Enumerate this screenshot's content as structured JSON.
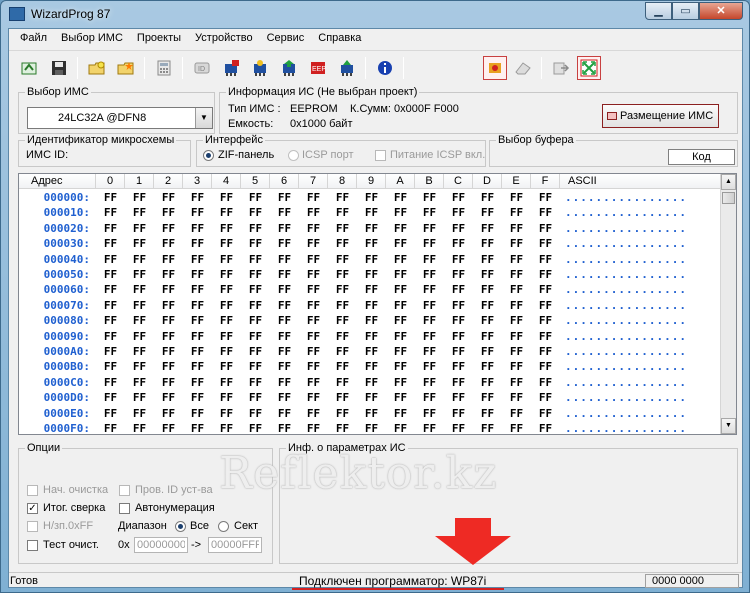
{
  "window": {
    "title": "WizardProg 87"
  },
  "menu": [
    "Файл",
    "Выбор ИМС",
    "Проекты",
    "Устройство",
    "Сервис",
    "Справка"
  ],
  "toolbar": {
    "icons": [
      "open-icon",
      "save-icon",
      "folder-open-icon",
      "folder-star-icon",
      "calculator-icon",
      "chip-id-icon",
      "chip-read-icon",
      "chip-blank-icon",
      "chip-write-icon",
      "chip-verify-icon",
      "chip-erase-icon",
      "info-icon",
      "chip-settings-icon",
      "eraser-icon",
      "export-icon",
      "fit-screen-icon"
    ]
  },
  "chip_select": {
    "group": "Выбор ИМС",
    "value": "24LC32A @DFN8"
  },
  "chip_info": {
    "group": "Информация ИС (Не выбран проект)",
    "type_label": "Тип ИМС :",
    "type_value": "EEPROM",
    "checksum_label": "К.Сумм:",
    "checksum_value": "0x000F F000",
    "capacity_label": "Емкость:",
    "capacity_value": "0x1000 байт",
    "placement_button": "Размещение ИМС"
  },
  "chip_id": {
    "group": "Идентификатор микросхемы",
    "label": "ИМС ID:"
  },
  "interface": {
    "group": "Интерфейс",
    "zif": "ZIF-панель",
    "icsp": "ICSP порт",
    "icsp_power": "Питание ICSP вкл."
  },
  "buffer": {
    "group": "Выбор буфера",
    "mode": "Код"
  },
  "hex_grid": {
    "address_header": "Адрес",
    "columns": [
      "0",
      "1",
      "2",
      "3",
      "4",
      "5",
      "6",
      "7",
      "8",
      "9",
      "A",
      "B",
      "C",
      "D",
      "E",
      "F"
    ],
    "ascii_header": "ASCII",
    "fill_value": "FF",
    "ascii_fill": "................",
    "rows": [
      "000000:",
      "000010:",
      "000020:",
      "000030:",
      "000040:",
      "000050:",
      "000060:",
      "000070:",
      "000080:",
      "000090:",
      "0000A0:",
      "0000B0:",
      "0000C0:",
      "0000D0:",
      "0000E0:",
      "0000F0:"
    ]
  },
  "options": {
    "group": "Опции",
    "initial_clear": "Нач. очистка",
    "check_id": "Пров. ID уст-ва",
    "final_verify": "Итог. сверка",
    "auto_numbering": "Автонумерация",
    "skip_ff": "Н/зп.0xFF",
    "range_label": "Диапазон",
    "range_all": "Все",
    "range_sector": "Сект",
    "test_erase": "Тест очист.",
    "hex_prefix": "0x",
    "range_from": "00000000",
    "range_arrow": "->",
    "range_to": "00000FFF"
  },
  "ic_params": {
    "group": "Инф. о параметрах ИС"
  },
  "watermark": "Reflektor.kz",
  "status": {
    "ready": "Готов",
    "connected": "Подключен программатор: WP87i",
    "position": "0000 0000"
  }
}
